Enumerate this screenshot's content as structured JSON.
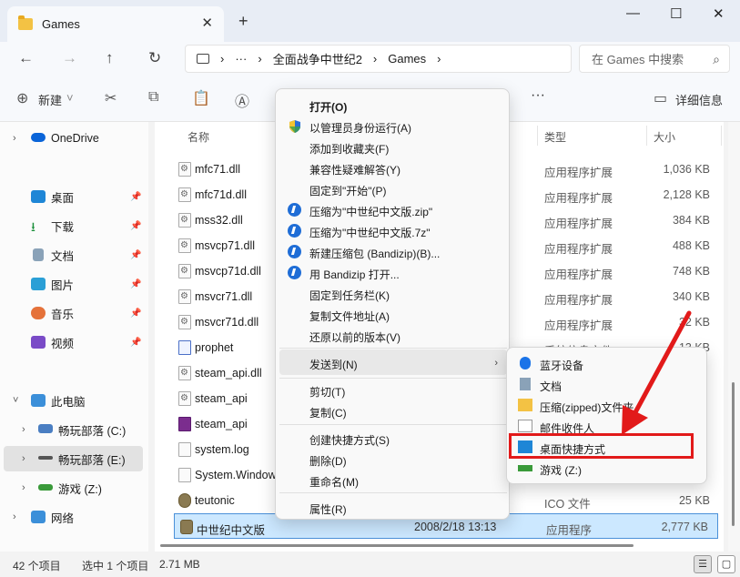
{
  "window": {
    "tab_title": "Games",
    "new_tab": "+",
    "minimize": "—",
    "maximize": "☐",
    "close": "✕"
  },
  "nav": {
    "more": "···",
    "breadcrumb": [
      "全面战争中世纪2",
      "Games"
    ],
    "search_placeholder": "在 Games 中搜索"
  },
  "toolbar": {
    "new_label": "新建",
    "more": "···",
    "details_label": "详细信息"
  },
  "sidebar": {
    "items": [
      {
        "label": "OneDrive"
      },
      {
        "label": "桌面"
      },
      {
        "label": "下载"
      },
      {
        "label": "文档"
      },
      {
        "label": "图片"
      },
      {
        "label": "音乐"
      },
      {
        "label": "视频"
      },
      {
        "label": "此电脑"
      },
      {
        "label": "畅玩部落 (C:)"
      },
      {
        "label": "畅玩部落 (E:)"
      },
      {
        "label": "游戏 (Z:)"
      },
      {
        "label": "网络"
      }
    ]
  },
  "filelist": {
    "headers": {
      "name": "名称",
      "type": "类型",
      "size": "大小"
    },
    "rows": [
      {
        "name": "mfc71.dll",
        "date": "",
        "type": "应用程序扩展",
        "size": "1,036 KB"
      },
      {
        "name": "mfc71d.dll",
        "date": "",
        "type": "应用程序扩展",
        "size": "2,128 KB"
      },
      {
        "name": "mss32.dll",
        "date": "",
        "type": "应用程序扩展",
        "size": "384 KB"
      },
      {
        "name": "msvcp71.dll",
        "date": "",
        "type": "应用程序扩展",
        "size": "488 KB"
      },
      {
        "name": "msvcp71d.dll",
        "date": "",
        "type": "应用程序扩展",
        "size": "748 KB"
      },
      {
        "name": "msvcr71.dll",
        "date": "",
        "type": "应用程序扩展",
        "size": "340 KB"
      },
      {
        "name": "msvcr71d.dll",
        "date": "",
        "type": "应用程序扩展",
        "size": "32 KB"
      },
      {
        "name": "prophet",
        "date": "",
        "type": "系统信息文件",
        "size": "13 KB"
      },
      {
        "name": "steam_api.dll",
        "date": "",
        "type": "",
        "size": ""
      },
      {
        "name": "steam_api",
        "date": "",
        "type": "",
        "size": ""
      },
      {
        "name": "steam_api",
        "date": "",
        "type": "",
        "size": ""
      },
      {
        "name": "system.log",
        "date": "",
        "type": "",
        "size": ""
      },
      {
        "name": "System.Window",
        "date": "",
        "type": "",
        "size": ""
      },
      {
        "name": "teutonic",
        "date": "",
        "type": "ICO 文件",
        "size": "25 KB"
      },
      {
        "name": "中世纪中文版",
        "date": "2008/2/18 13:13",
        "type": "应用程序",
        "size": "2,777 KB"
      }
    ]
  },
  "status": {
    "count": "42 个项目",
    "selected": "选中 1 个项目",
    "size": "2.71 MB"
  },
  "context_menu": {
    "items": [
      {
        "label": "打开(O)"
      },
      {
        "label": "以管理员身份运行(A)"
      },
      {
        "label": "添加到收藏夹(F)"
      },
      {
        "label": "兼容性疑难解答(Y)"
      },
      {
        "label": "固定到\"开始\"(P)"
      },
      {
        "label": "压缩为\"中世纪中文版.zip\""
      },
      {
        "label": "压缩为\"中世纪中文版.7z\""
      },
      {
        "label": "新建压缩包 (Bandizip)(B)..."
      },
      {
        "label": "用 Bandizip 打开..."
      },
      {
        "label": "固定到任务栏(K)"
      },
      {
        "label": "复制文件地址(A)"
      },
      {
        "label": "还原以前的版本(V)"
      },
      {
        "label": "发送到(N)"
      },
      {
        "label": "剪切(T)"
      },
      {
        "label": "复制(C)"
      },
      {
        "label": "创建快捷方式(S)"
      },
      {
        "label": "删除(D)"
      },
      {
        "label": "重命名(M)"
      },
      {
        "label": "属性(R)"
      }
    ]
  },
  "sendto_menu": {
    "items": [
      {
        "label": "蓝牙设备"
      },
      {
        "label": "文档"
      },
      {
        "label": "压缩(zipped)文件夹"
      },
      {
        "label": "邮件收件人"
      },
      {
        "label": "桌面快捷方式"
      },
      {
        "label": "游戏 (Z:)"
      }
    ]
  },
  "colors": {
    "accent": "#0067c0",
    "selection": "#cce8ff",
    "annotation": "#e21a1a"
  }
}
